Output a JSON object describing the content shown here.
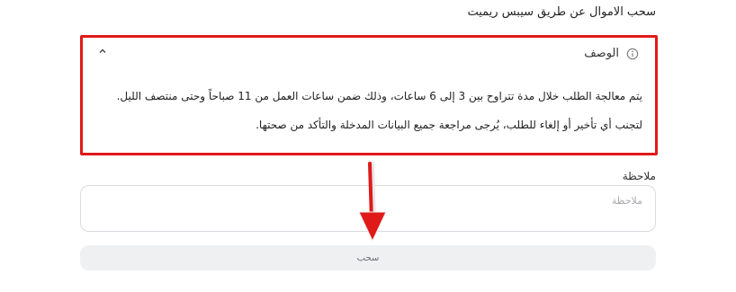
{
  "page": {
    "title": "سحب الاموال عن طريق سيبس ريميت"
  },
  "description_panel": {
    "header_label": "الوصف",
    "line1": "يتم معالجة الطلب خلال مدة تتراوح بين 3 إلى 6 ساعات، وذلك ضمن ساعات العمل من 11 صباحاً وحتى منتصف الليل.",
    "line2": "لتجنب أي تأخير أو إلغاء للطلب، يُرجى مراجعة جميع البيانات المدخلة والتأكد من صحتها.",
    "expanded": true,
    "highlight_color": "#e01919"
  },
  "note": {
    "label": "ملاحظة",
    "placeholder": "ملاحظة",
    "value": ""
  },
  "submit": {
    "label": "سحب"
  },
  "icons": {
    "info": "info-circle-icon",
    "collapse": "chevron-up-icon",
    "annotation": "red-arrow-down-icon"
  }
}
